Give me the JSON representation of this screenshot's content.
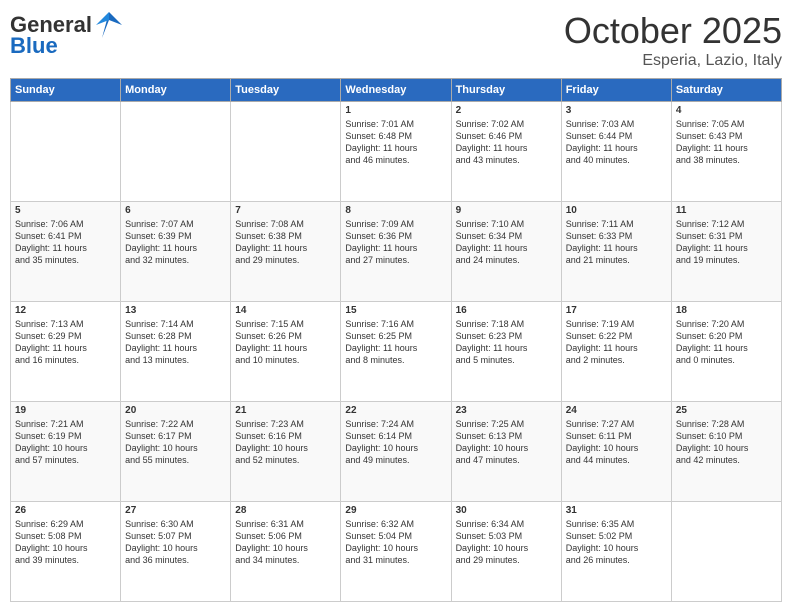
{
  "header": {
    "logo_general": "General",
    "logo_blue": "Blue",
    "month_title": "October 2025",
    "location": "Esperia, Lazio, Italy"
  },
  "days_of_week": [
    "Sunday",
    "Monday",
    "Tuesday",
    "Wednesday",
    "Thursday",
    "Friday",
    "Saturday"
  ],
  "weeks": [
    {
      "cells": [
        {
          "day": null,
          "data": null
        },
        {
          "day": null,
          "data": null
        },
        {
          "day": null,
          "data": null
        },
        {
          "day": "1",
          "data": "Sunrise: 7:01 AM\nSunset: 6:48 PM\nDaylight: 11 hours\nand 46 minutes."
        },
        {
          "day": "2",
          "data": "Sunrise: 7:02 AM\nSunset: 6:46 PM\nDaylight: 11 hours\nand 43 minutes."
        },
        {
          "day": "3",
          "data": "Sunrise: 7:03 AM\nSunset: 6:44 PM\nDaylight: 11 hours\nand 40 minutes."
        },
        {
          "day": "4",
          "data": "Sunrise: 7:05 AM\nSunset: 6:43 PM\nDaylight: 11 hours\nand 38 minutes."
        }
      ]
    },
    {
      "cells": [
        {
          "day": "5",
          "data": "Sunrise: 7:06 AM\nSunset: 6:41 PM\nDaylight: 11 hours\nand 35 minutes."
        },
        {
          "day": "6",
          "data": "Sunrise: 7:07 AM\nSunset: 6:39 PM\nDaylight: 11 hours\nand 32 minutes."
        },
        {
          "day": "7",
          "data": "Sunrise: 7:08 AM\nSunset: 6:38 PM\nDaylight: 11 hours\nand 29 minutes."
        },
        {
          "day": "8",
          "data": "Sunrise: 7:09 AM\nSunset: 6:36 PM\nDaylight: 11 hours\nand 27 minutes."
        },
        {
          "day": "9",
          "data": "Sunrise: 7:10 AM\nSunset: 6:34 PM\nDaylight: 11 hours\nand 24 minutes."
        },
        {
          "day": "10",
          "data": "Sunrise: 7:11 AM\nSunset: 6:33 PM\nDaylight: 11 hours\nand 21 minutes."
        },
        {
          "day": "11",
          "data": "Sunrise: 7:12 AM\nSunset: 6:31 PM\nDaylight: 11 hours\nand 19 minutes."
        }
      ]
    },
    {
      "cells": [
        {
          "day": "12",
          "data": "Sunrise: 7:13 AM\nSunset: 6:29 PM\nDaylight: 11 hours\nand 16 minutes."
        },
        {
          "day": "13",
          "data": "Sunrise: 7:14 AM\nSunset: 6:28 PM\nDaylight: 11 hours\nand 13 minutes."
        },
        {
          "day": "14",
          "data": "Sunrise: 7:15 AM\nSunset: 6:26 PM\nDaylight: 11 hours\nand 10 minutes."
        },
        {
          "day": "15",
          "data": "Sunrise: 7:16 AM\nSunset: 6:25 PM\nDaylight: 11 hours\nand 8 minutes."
        },
        {
          "day": "16",
          "data": "Sunrise: 7:18 AM\nSunset: 6:23 PM\nDaylight: 11 hours\nand 5 minutes."
        },
        {
          "day": "17",
          "data": "Sunrise: 7:19 AM\nSunset: 6:22 PM\nDaylight: 11 hours\nand 2 minutes."
        },
        {
          "day": "18",
          "data": "Sunrise: 7:20 AM\nSunset: 6:20 PM\nDaylight: 11 hours\nand 0 minutes."
        }
      ]
    },
    {
      "cells": [
        {
          "day": "19",
          "data": "Sunrise: 7:21 AM\nSunset: 6:19 PM\nDaylight: 10 hours\nand 57 minutes."
        },
        {
          "day": "20",
          "data": "Sunrise: 7:22 AM\nSunset: 6:17 PM\nDaylight: 10 hours\nand 55 minutes."
        },
        {
          "day": "21",
          "data": "Sunrise: 7:23 AM\nSunset: 6:16 PM\nDaylight: 10 hours\nand 52 minutes."
        },
        {
          "day": "22",
          "data": "Sunrise: 7:24 AM\nSunset: 6:14 PM\nDaylight: 10 hours\nand 49 minutes."
        },
        {
          "day": "23",
          "data": "Sunrise: 7:25 AM\nSunset: 6:13 PM\nDaylight: 10 hours\nand 47 minutes."
        },
        {
          "day": "24",
          "data": "Sunrise: 7:27 AM\nSunset: 6:11 PM\nDaylight: 10 hours\nand 44 minutes."
        },
        {
          "day": "25",
          "data": "Sunrise: 7:28 AM\nSunset: 6:10 PM\nDaylight: 10 hours\nand 42 minutes."
        }
      ]
    },
    {
      "cells": [
        {
          "day": "26",
          "data": "Sunrise: 6:29 AM\nSunset: 5:08 PM\nDaylight: 10 hours\nand 39 minutes."
        },
        {
          "day": "27",
          "data": "Sunrise: 6:30 AM\nSunset: 5:07 PM\nDaylight: 10 hours\nand 36 minutes."
        },
        {
          "day": "28",
          "data": "Sunrise: 6:31 AM\nSunset: 5:06 PM\nDaylight: 10 hours\nand 34 minutes."
        },
        {
          "day": "29",
          "data": "Sunrise: 6:32 AM\nSunset: 5:04 PM\nDaylight: 10 hours\nand 31 minutes."
        },
        {
          "day": "30",
          "data": "Sunrise: 6:34 AM\nSunset: 5:03 PM\nDaylight: 10 hours\nand 29 minutes."
        },
        {
          "day": "31",
          "data": "Sunrise: 6:35 AM\nSunset: 5:02 PM\nDaylight: 10 hours\nand 26 minutes."
        },
        {
          "day": null,
          "data": null
        }
      ]
    }
  ]
}
